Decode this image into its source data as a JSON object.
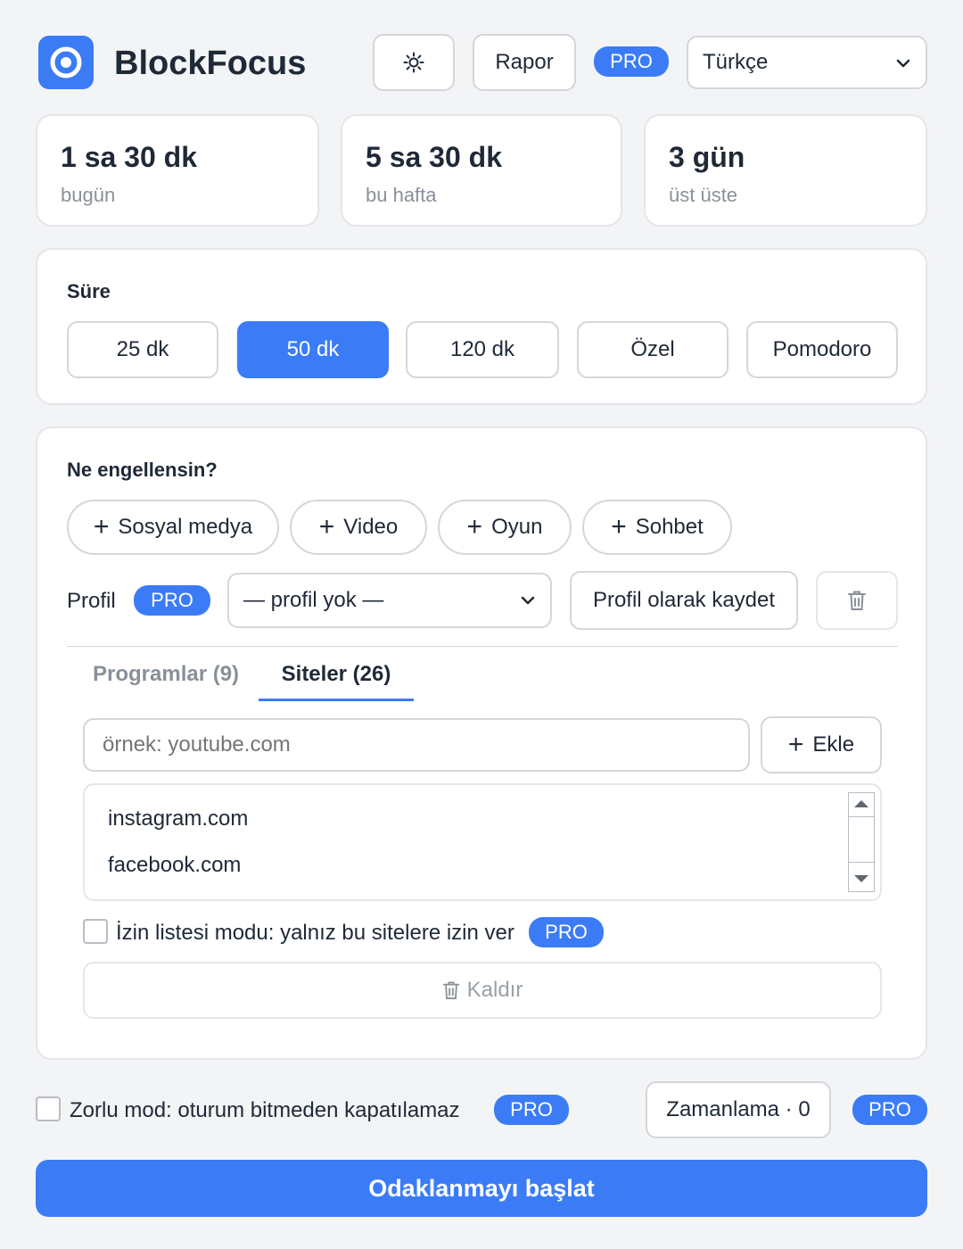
{
  "header": {
    "app_name": "BlockFocus",
    "theme_icon": "sun-icon",
    "report_label": "Rapor",
    "pro_label": "PRO",
    "language": "Türkçe"
  },
  "stats": [
    {
      "value": "1 sa 30 dk",
      "label": "bugün"
    },
    {
      "value": "5 sa 30 dk",
      "label": "bu hafta"
    },
    {
      "value": "3 gün",
      "label": "üst üste"
    }
  ],
  "duration": {
    "title": "Süre",
    "options": [
      "25 dk",
      "50 dk",
      "120 dk",
      "Özel",
      "Pomodoro"
    ],
    "selected": "50 dk"
  },
  "block": {
    "title": "Ne engellensin?",
    "categories": [
      "Sosyal medya",
      "Video",
      "Oyun",
      "Sohbet"
    ],
    "profile_label": "Profil",
    "profile_pro": "PRO",
    "profile_select": "— profil yok —",
    "save_profile": "Profil olarak kaydet",
    "tabs": [
      "Programlar (9)",
      "Siteler (26)"
    ],
    "active_tab": "Siteler (26)",
    "site_placeholder": "örnek: youtube.com",
    "add_label": "Ekle",
    "sites": [
      "instagram.com",
      "facebook.com"
    ],
    "allowlist_label": "İzin listesi modu: yalnız bu sitelere izin ver",
    "allowlist_pro": "PRO",
    "remove_label": "Kaldır"
  },
  "footer": {
    "strict_label": "Zorlu mod: oturum bitmeden kapatılamaz",
    "strict_pro": "PRO",
    "schedule_label": "Zamanlama · 0",
    "schedule_pro": "PRO",
    "start_label": "Odaklanmayı başlat"
  },
  "colors": {
    "accent": "#3b7cf6",
    "background": "#f3f4f6"
  }
}
